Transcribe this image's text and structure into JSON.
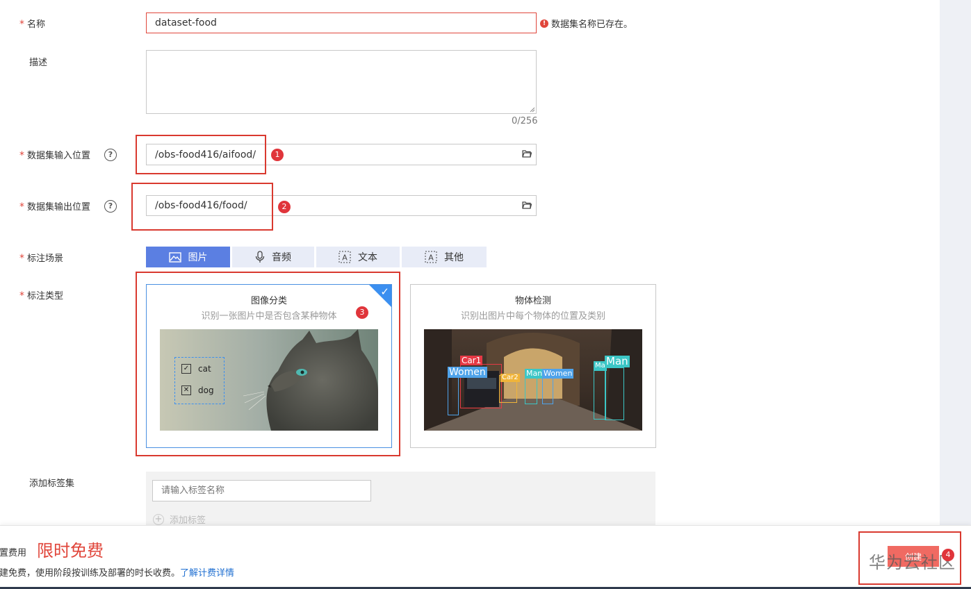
{
  "form": {
    "name": {
      "label": "名称",
      "value": "dataset-food",
      "error": "数据集名称已存在。"
    },
    "description": {
      "label": "描述",
      "counter": "0/256"
    },
    "input_location": {
      "label": "数据集输入位置",
      "value": "/obs-food416/aifood/"
    },
    "output_location": {
      "label": "数据集输出位置",
      "value": "/obs-food416/food/"
    },
    "scene": {
      "label": "标注场景",
      "tabs": [
        {
          "label": "图片",
          "icon": "image-icon",
          "active": true
        },
        {
          "label": "音频",
          "icon": "microphone-icon",
          "active": false
        },
        {
          "label": "文本",
          "icon": "text-icon",
          "active": false
        },
        {
          "label": "其他",
          "icon": "text-icon",
          "active": false
        }
      ]
    },
    "type": {
      "label": "标注类型",
      "cards": [
        {
          "title": "图像分类",
          "subtitle": "识别一张图片中是否包含某种物体",
          "selected": true,
          "options": [
            "cat",
            "dog"
          ]
        },
        {
          "title": "物体检测",
          "subtitle": "识别出图片中每个物体的位置及类别",
          "selected": false,
          "boxes": [
            "Car1",
            "Women",
            "Car2",
            "Man",
            "Women",
            "Ma",
            "Man"
          ]
        }
      ]
    },
    "tagset": {
      "label": "添加标签集",
      "placeholder": "请输入标签名称",
      "add_label": "添加标签"
    }
  },
  "annotations": {
    "badges": [
      "1",
      "2",
      "3",
      "4"
    ]
  },
  "footer": {
    "fee_label": "配置费用",
    "fee_value": "限时免费",
    "note": "创建免费，使用阶段按训练及部署的时长收费。",
    "link": "了解计费详情",
    "create_button": "创建",
    "watermark": "华为云社区"
  },
  "colors": {
    "accent": "#5b7fe2",
    "error": "#e0463b",
    "link": "#1f6fd1",
    "fee": "#e0463b"
  }
}
